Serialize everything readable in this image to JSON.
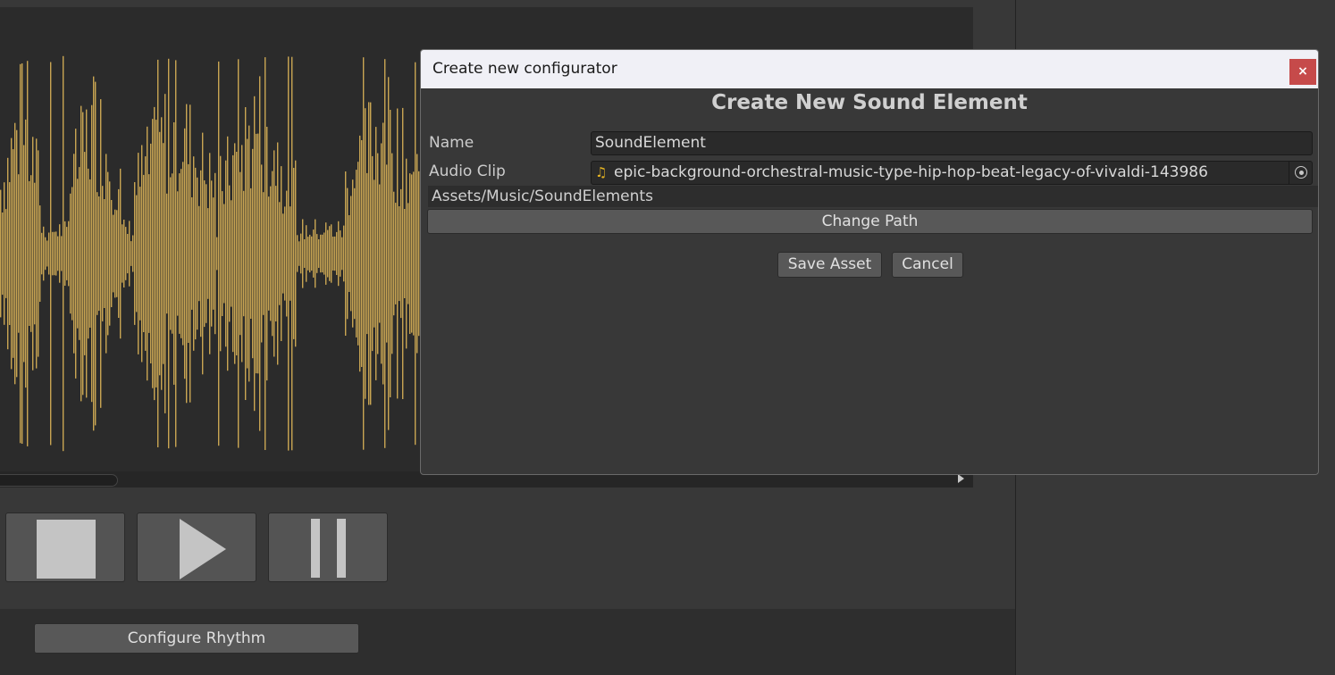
{
  "audio_panel": {
    "waveform_color": "#c9a553",
    "waveform_bg": "#2b2b2b",
    "transport": {
      "stop_icon": "stop-icon",
      "play_icon": "play-icon",
      "pause_icon": "pause-icon"
    },
    "configure_rhythm_label": "Configure Rhythm"
  },
  "dialog": {
    "window_title": "Create new configurator",
    "close_label": "×",
    "heading": "Create New Sound Element",
    "name_label": "Name",
    "name_value": "SoundElement",
    "audio_clip_label": "Audio Clip",
    "audio_clip_value": "epic-background-orchestral-music-type-hip-hop-beat-legacy-of-vivaldi-143986",
    "audio_clip_icon": "music-note-icon",
    "path": "Assets/Music/SoundElements",
    "change_path_label": "Change Path",
    "save_label": "Save Asset",
    "cancel_label": "Cancel",
    "close_color": "#c64a4a",
    "note_color": "#e6b422"
  }
}
